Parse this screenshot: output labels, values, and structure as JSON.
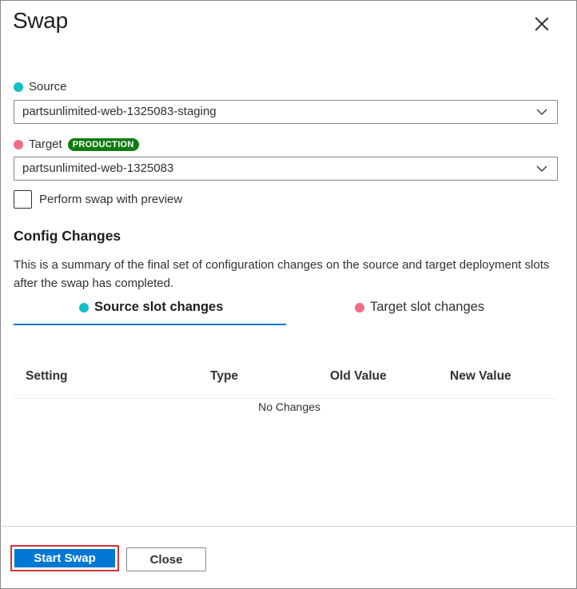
{
  "dialog": {
    "title": "Swap",
    "close_icon": "close-icon"
  },
  "source": {
    "label": "Source",
    "selected": "partsunlimited-web-1325083-staging",
    "dot_color": "#13c0c8"
  },
  "target": {
    "label": "Target",
    "badge": "PRODUCTION",
    "badge_color": "#107c10",
    "selected": "partsunlimited-web-1325083",
    "dot_color": "#f06e85"
  },
  "preview": {
    "label": "Perform swap with preview",
    "checked": false
  },
  "config": {
    "title": "Config Changes",
    "description": "This is a summary of the final set of configuration changes on the source and target deployment slots after the swap has completed."
  },
  "tabs": [
    {
      "label": "Source slot changes",
      "active": true
    },
    {
      "label": "Target slot changes",
      "active": false
    }
  ],
  "table": {
    "columns": [
      "Setting",
      "Type",
      "Old Value",
      "New Value"
    ],
    "empty_message": "No Changes"
  },
  "footer": {
    "primary_label": "Start Swap",
    "secondary_label": "Close",
    "accent": "#0078d4"
  }
}
